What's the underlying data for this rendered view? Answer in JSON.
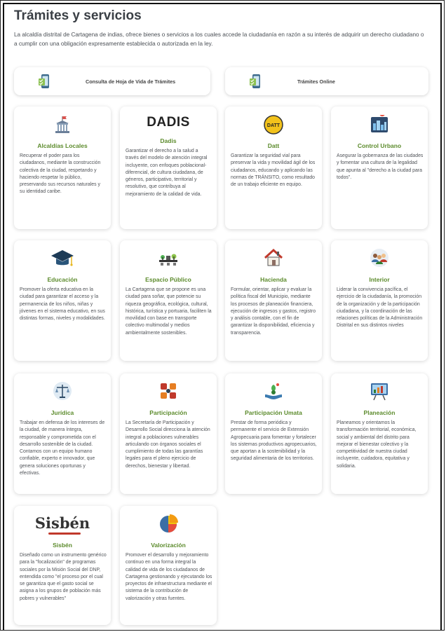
{
  "page": {
    "title": "Trámites y servicios",
    "intro": "La alcaldía distrital de Cartagena de indias, ofrece bienes o servicios a los cuales accede la ciudadanía en razón a su interés de adquirir un derecho ciudadano o a cumplir con una obligación expresamente establecida o autorizada en la ley."
  },
  "top_buttons": [
    {
      "label": "Consulta de Hoja de Vida de Trámites",
      "icon": "phone-checklist-icon"
    },
    {
      "label": "Trámites Online",
      "icon": "phone-checklist-icon"
    }
  ],
  "logos": {
    "dadis": "DADIS",
    "datt": "DATT",
    "sisben": "Sisbén"
  },
  "colors": {
    "title_green": "#5c8b2c",
    "heading": "#3a3f45"
  },
  "cards": [
    {
      "title": "Alcaldías Locales",
      "icon": "building-flag-icon",
      "desc": "Recuperar el poder para los ciudadanos, mediante la construcción colectiva de la ciudad, respetando y haciendo respetar lo público, preservando sus recursos naturales y su identidad caribe."
    },
    {
      "title": "Dadis",
      "icon": "dadis-logo",
      "desc": "Garantizar el derecho a la salud a través del modelo de atención integral incluyente, con enfoques poblacional-diferencial, de cultura ciudadana, de géneros, participativo, territorial y resolutivo, que contribuya al mejoramiento de la calidad de vida."
    },
    {
      "title": "Datt",
      "icon": "datt-logo",
      "desc": "Garantizar la seguridad vial para preservar la vida y movilidad ágil de los ciudadanos, educando y aplicando las normas de TRÁNSITO, como resultado de un trabajo eficiente en equipo."
    },
    {
      "title": "Control Urbano",
      "icon": "city-map-icon",
      "desc": "Asegurar la gobernanza de las ciudades y fomentar una cultura de la legalidad que apunta al \"derecho a la ciudad para todos\"."
    },
    {
      "title": "Educación",
      "icon": "graduation-cap-icon",
      "desc": "Promover la oferta educativa en la ciudad para garantizar el acceso y la permanencia de los niños, niñas y jóvenes en el sistema educativo, en sus distintas formas, niveles y modalidades."
    },
    {
      "title": "Espacio Público",
      "icon": "public-space-icon",
      "desc": "La Cartagena que se propone es una ciudad para soñar, que potencie su riqueza geográfica, ecológica, cultural, histórica, turística y portuaria, faciliten la movilidad con base en transporte colectivo multimodal y medios ambientalmente sostenibles."
    },
    {
      "title": "Hacienda",
      "icon": "house-icon",
      "desc": "Formular, orientar, aplicar y evaluar la política fiscal del Municipio, mediante los procesos de planeación financiera, ejecución de ingresos y gastos, registro y análisis contable, con el fin de garantizar la disponibilidad, eficiencia y transparencia."
    },
    {
      "title": "Interior",
      "icon": "people-group-icon",
      "desc": "Liderar la convivencia pacífica, el ejercicio de la ciudadanía, la promoción de la organización y de la participación ciudadana, y la coordinación de las relaciones políticas de la Administración Distrital en sus distintos niveles"
    },
    {
      "title": "Jurídica",
      "icon": "scales-icon",
      "desc": "Trabajar en defensa de los intereses de la ciudad, de manera íntegra, responsable y comprometida con el desarrollo sostenible de la ciudad. Contamos con un equipo humano confiable, experto e innovador, que genera soluciones oportunas y efectivas."
    },
    {
      "title": "Participación",
      "icon": "puzzle-icon",
      "desc": "La Secretaría de Participación y Desarrollo Social direcciona la atención integral a poblaciones vulnerables articulando con órganos sociales el cumplimiento de todas las garantías legales para el pleno ejercicio de derechos, bienestar y libertad."
    },
    {
      "title": "Participación Umata",
      "icon": "hands-plant-icon",
      "desc": "Prestar de forma periódica y permanente el servicio de Extensión Agropecuaria para fomentar y fortalecer los sistemas productivos agropecuarios, que aportan a la sostenibilidad y la seguridad alimentaria de los territorios."
    },
    {
      "title": "Planeación",
      "icon": "planning-board-icon",
      "desc": "Planeamos y orientamos la transformación territorial, económica, social y ambiental del distrito para mejorar el bienestar colectivo y la competitividad de nuestra ciudad incluyente, cuidadora, equitativa y solidaria."
    },
    {
      "title": "Sisbén",
      "icon": "sisben-logo",
      "desc": "Diseñado como un instrumento genérico para la \"focalización\" de programas sociales por la Misión Social del DNP, entendida como \"el proceso por el cual se garantiza que el gasto social se asigna a los grupos de población más pobres y vulnerables\""
    },
    {
      "title": "Valorización",
      "icon": "pie-chart-icon",
      "desc": "Promover el desarrollo y mejoramiento continuo en una forma integral la calidad de vida de los ciudadanos de Cartagena gestionando y ejecutando los proyectos de infraestructura mediante el sistema de la contribución de valorización y otras fuentes."
    }
  ]
}
